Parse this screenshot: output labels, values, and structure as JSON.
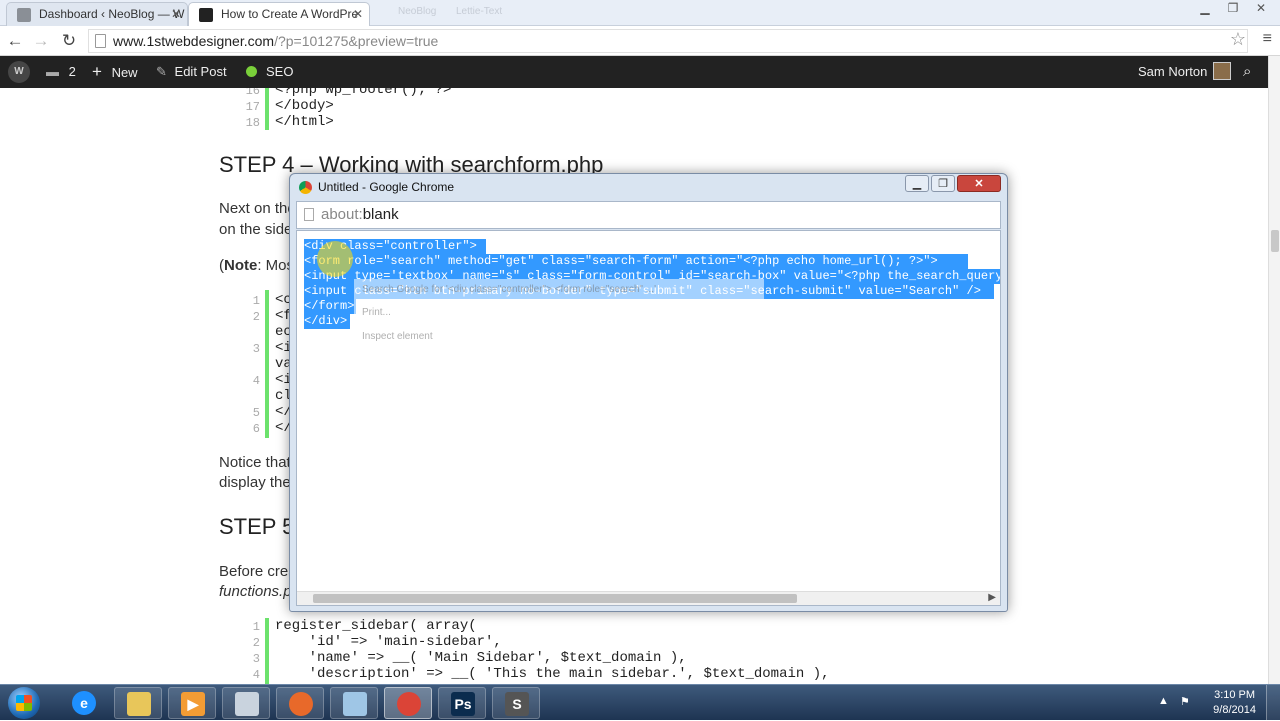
{
  "browser": {
    "tabs": [
      {
        "title": "Dashboard ‹ NeoBlog — W",
        "favicon_color": "#8a8f96"
      },
      {
        "title": "How to Create A WordPre",
        "favicon_color": "#222222"
      }
    ],
    "ghost_tabs": [
      "NeoBlog",
      "Lettie-Text"
    ],
    "url_host": "www.1stwebdesigner.com",
    "url_rest": "/?p=101275&preview=true"
  },
  "adminbar": {
    "comments_count": "2",
    "new_label": "New",
    "edit_label": "Edit Post",
    "seo_label": "SEO",
    "user_name": "Sam Norton",
    "colors": {
      "bar": "#222222",
      "seo_status": "#7ad03a"
    }
  },
  "article": {
    "top_code": [
      {
        "no": "16",
        "text": "<?php wp_footer(); ?>"
      },
      {
        "no": "17",
        "text": "</body>"
      },
      {
        "no": "18",
        "text": "</html>"
      }
    ],
    "step4_heading": "STEP 4 – Working with searchform.php",
    "step4_p1a": "Next on the",
    "step4_p1b": "on the side",
    "note_label": "Note",
    "note_rest": ": Mos",
    "mid_code": [
      {
        "no": "1",
        "text": "<c"
      },
      {
        "no": "2",
        "text": "<f"
      },
      {
        "no": "",
        "text": "ec"
      },
      {
        "no": "3",
        "text": "<i"
      },
      {
        "no": "",
        "text": "va"
      },
      {
        "no": "4",
        "text": "<i"
      },
      {
        "no": "",
        "text": "cl"
      },
      {
        "no": "5",
        "text": "</"
      },
      {
        "no": "6",
        "text": "</"
      }
    ],
    "notice_a": "Notice that",
    "notice_b": "display the",
    "step5_heading": "STEP 5",
    "before_text": "Before crea",
    "functions_text": "functions.p",
    "bottom_code": [
      {
        "no": "1",
        "text": "register_sidebar( array("
      },
      {
        "no": "2",
        "text": "    'id' => 'main-sidebar',"
      },
      {
        "no": "3",
        "text": "    'name' => __( 'Main Sidebar', $text_domain ),"
      },
      {
        "no": "4",
        "text": "    'description' => __( 'This the main sidebar.', $text_domain ),"
      }
    ]
  },
  "popup": {
    "title": "Untitled - Google Chrome",
    "address_scheme": "about:",
    "address_rest": "blank",
    "selected_code": [
      "<div class=\"controller\">",
      "<form role=\"search\" method=\"get\" class=\"search-form\" action=\"<?php echo home_url(); ?>\">",
      "<input type='textbox' name=\"s\" class=\"form-control\" id=\"search-box\" value=\"<?php the_search_query(); ?>\" placeholder=\"Search...\"/>",
      "<input class=\"btn btn-primary no-border\" type=\"submit\" class=\"search-submit\" value=\"Search\" />",
      "</form>",
      "</div>"
    ],
    "context_menu": [
      "Search Google for '<div class=\"controller\"> <form role=\"search\" ...'",
      "Print...",
      "Inspect element"
    ],
    "selection_color": "#3399ff"
  },
  "taskbar": {
    "time": "3:10 PM",
    "date": "9/8/2014",
    "apps": [
      {
        "name": "internet-explorer",
        "color": "#1e90ff",
        "glyph": "e"
      },
      {
        "name": "file-explorer",
        "color": "#e8c65a",
        "glyph": ""
      },
      {
        "name": "media-player",
        "color": "#f39c34",
        "glyph": "▶"
      },
      {
        "name": "calculator",
        "color": "#c9d3de",
        "glyph": ""
      },
      {
        "name": "firefox",
        "color": "#e8692a",
        "glyph": ""
      },
      {
        "name": "notepad",
        "color": "#9fc6e6",
        "glyph": ""
      },
      {
        "name": "chrome",
        "color": "#db4437",
        "glyph": ""
      },
      {
        "name": "photoshop",
        "color": "#0b2c4e",
        "glyph": "Ps"
      },
      {
        "name": "sublime-text",
        "color": "#555555",
        "glyph": "S"
      }
    ]
  }
}
